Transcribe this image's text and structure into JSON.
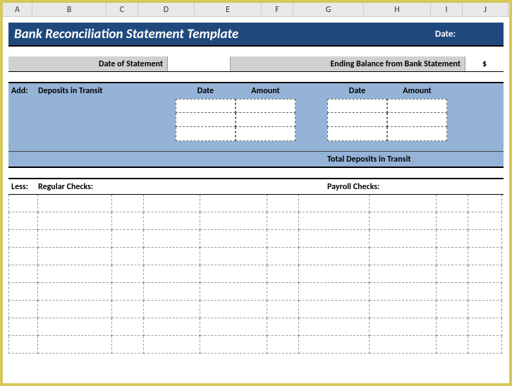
{
  "columns": [
    "A",
    "B",
    "C",
    "D",
    "E",
    "F",
    "G",
    "H",
    "I",
    "J"
  ],
  "title": "Bank Reconciliation Statement Template",
  "dateLabel": "Date:",
  "statementRow": {
    "dateOfStatement": "Date of Statement",
    "endingBalance": "Ending Balance from Bank Statement",
    "dollar": "$"
  },
  "depositsSection": {
    "add": "Add:",
    "label": "Deposits in Transit",
    "colDate": "Date",
    "colAmount": "Amount",
    "totalLabel": "Total Deposits in Transit"
  },
  "lessSection": {
    "less": "Less:",
    "regular": "Regular Checks:",
    "payroll": "Payroll Checks:"
  }
}
